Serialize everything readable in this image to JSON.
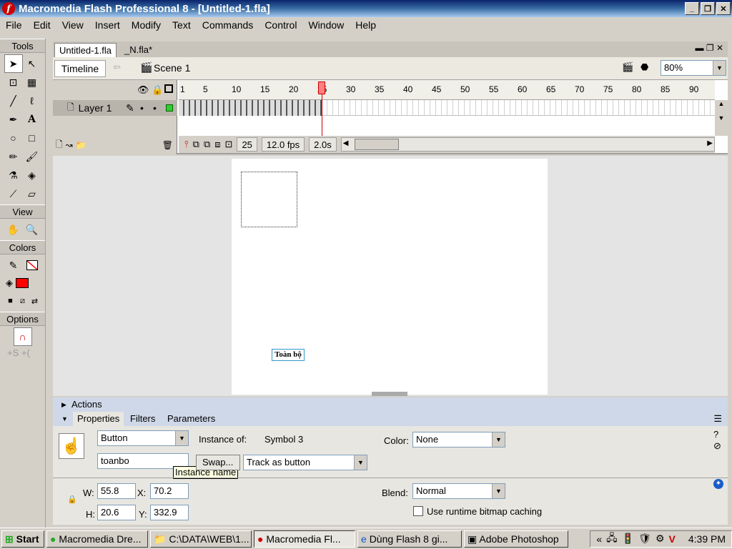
{
  "window": {
    "title": "Macromedia Flash Professional 8 - [Untitled-1.fla]"
  },
  "menu": [
    "File",
    "Edit",
    "View",
    "Insert",
    "Modify",
    "Text",
    "Commands",
    "Control",
    "Window",
    "Help"
  ],
  "tools": {
    "header": "Tools",
    "view_header": "View",
    "colors_header": "Colors",
    "options_header": "Options",
    "stroke_color": "#ff0000",
    "fill_color": "#ff0000"
  },
  "document": {
    "tabs": [
      "Untitled-1.fla",
      "_N.fla*"
    ],
    "timeline_button": "Timeline",
    "scene_label": "Scene 1",
    "zoom": "80%"
  },
  "timeline": {
    "ruler": [
      "1",
      "5",
      "10",
      "15",
      "20",
      "25",
      "30",
      "35",
      "40",
      "45",
      "50",
      "55",
      "60",
      "65",
      "70",
      "75",
      "80",
      "85",
      "90"
    ],
    "layer_name": "Layer 1",
    "current_frame": "25",
    "fps": "12.0 fps",
    "elapsed": "2.0s"
  },
  "stage": {
    "button_text": "Toàn bộ"
  },
  "panels": {
    "actions_label": "Actions",
    "tabs": [
      "Properties",
      "Filters",
      "Parameters"
    ]
  },
  "properties": {
    "symbol_type": "Button",
    "instance_of_label": "Instance of:",
    "instance_of_value": "Symbol 3",
    "instance_name": "toanbo",
    "tooltip": "Instance name",
    "swap_label": "Swap...",
    "track_mode": "Track as button",
    "color_label": "Color:",
    "color_value": "None",
    "w_label": "W:",
    "w": "55.8",
    "x_label": "X:",
    "x": "70.2",
    "h_label": "H:",
    "h": "20.6",
    "y_label": "Y:",
    "y": "332.9",
    "blend_label": "Blend:",
    "blend_value": "Normal",
    "cache_label": "Use runtime bitmap caching"
  },
  "taskbar": {
    "start": "Start",
    "items": [
      "Macromedia Dre...",
      "C:\\DATA\\WEB\\1...",
      "Macromedia Fl...",
      "Dùng Flash 8 gi...",
      "Adobe Photoshop"
    ],
    "clock": "4:39 PM"
  }
}
